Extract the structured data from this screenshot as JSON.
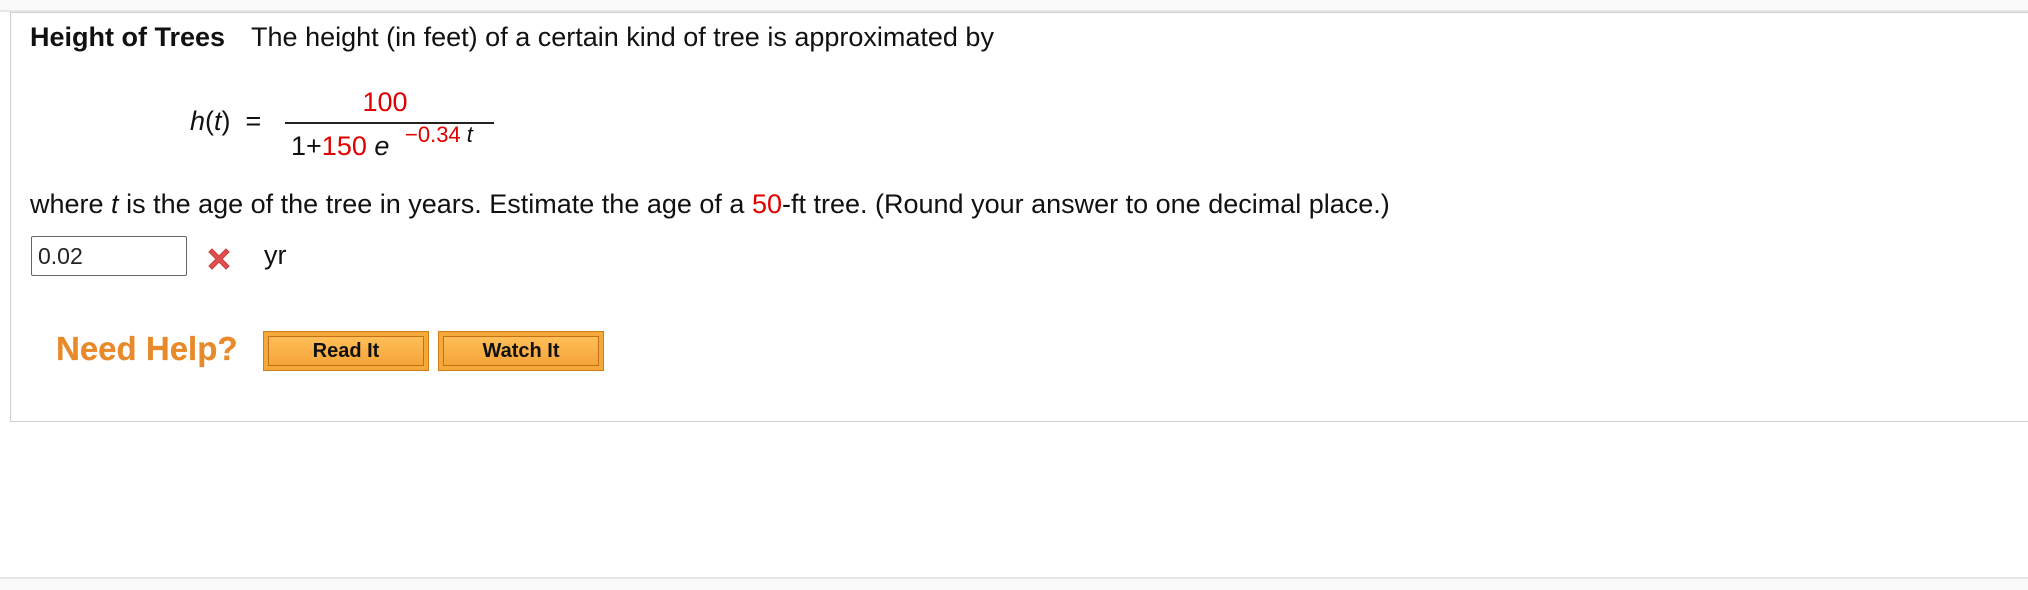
{
  "problem": {
    "title": "Height of Trees",
    "intro": "The height (in feet) of a certain kind of tree is approximated by",
    "formula": {
      "lhs_func": "h",
      "lhs_var": "t",
      "equals": "=",
      "numerator": "100",
      "den_one_plus": "1+",
      "den_coef": "150",
      "den_base": "e",
      "exp_coef": "−0.34",
      "exp_var": "t"
    },
    "question_pre": "where ",
    "question_var": "t",
    "question_mid": " is the age of the tree in years. Estimate the age of a ",
    "question_value": "50",
    "question_post": "-ft tree. (Round your answer to one decimal place.)"
  },
  "answer": {
    "value": "0.02",
    "status_icon": "red-x-icon",
    "unit": "yr"
  },
  "help": {
    "label": "Need Help?",
    "read_button": "Read It",
    "watch_button": "Watch It"
  },
  "colors": {
    "parameter": "#e00000",
    "help_text": "#e8892a",
    "button_fill": "#f6a93b",
    "wrong_icon": "#e05050"
  }
}
